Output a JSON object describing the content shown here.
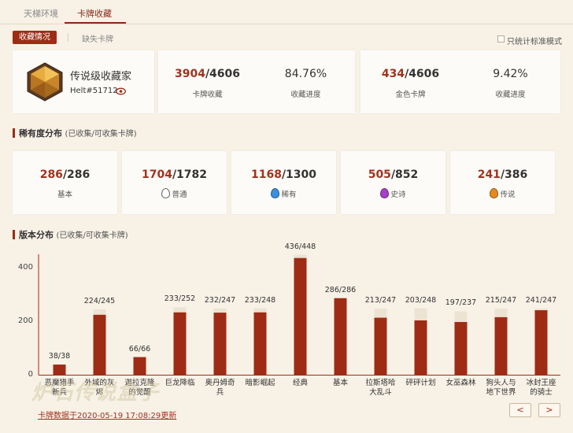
{
  "topnav": {
    "tab1": "天梯环境",
    "tab2": "卡牌收藏"
  },
  "subnav": {
    "active": "收藏情况",
    "other": "缺失卡牌",
    "checkbox_label": "只统计标准模式"
  },
  "profile": {
    "title": "传说级收藏家",
    "battletag": "Helt#51712"
  },
  "stats": [
    {
      "owned": "3904",
      "total": "/4606",
      "label": "卡牌收藏",
      "pct": "84.76%",
      "pct_label": "收藏进度"
    },
    {
      "owned": "434",
      "total": "/4606",
      "label": "金色卡牌",
      "pct": "9.42%",
      "pct_label": "收藏进度"
    }
  ],
  "rarity": {
    "title": "稀有度分布",
    "subtitle": "(已收集/可收集卡牌)",
    "items": [
      {
        "owned": "286",
        "total": "/286",
        "label": "基本",
        "gem": "",
        "color": ""
      },
      {
        "owned": "1704",
        "total": "/1782",
        "label": "普通",
        "gem": "common",
        "color": "#ffffff"
      },
      {
        "owned": "1168",
        "total": "/1300",
        "label": "稀有",
        "gem": "rare",
        "color": "#3a8fe0"
      },
      {
        "owned": "505",
        "total": "/852",
        "label": "史诗",
        "gem": "epic",
        "color": "#a640c9"
      },
      {
        "owned": "241",
        "total": "/386",
        "label": "传说",
        "gem": "legendary",
        "color": "#e78a1e"
      }
    ]
  },
  "expansion": {
    "title": "版本分布",
    "subtitle": "(已收集/可收集卡牌)"
  },
  "chart_data": {
    "type": "bar",
    "ylim": [
      0,
      480
    ],
    "yticks": [
      "0",
      "200",
      "400"
    ],
    "categories": [
      "恶魔猎手\n新兵",
      "外域的灰\n烬",
      "迦拉克隆\n的觉醒",
      "巨龙降临",
      "奥丹姆奇\n兵",
      "暗影崛起",
      "经典",
      "基本",
      "拉斯塔哈\n大乱斗",
      "砰砰计划",
      "女巫森林",
      "狗头人与\n地下世界",
      "冰封王座\n的骑士"
    ],
    "value_labels": [
      "38/38",
      "224/245",
      "66/66",
      "233/252",
      "232/247",
      "233/248",
      "436/448",
      "286/286",
      "213/247",
      "203/248",
      "197/237",
      "215/247",
      "241/247"
    ],
    "series": [
      {
        "name": "已收集",
        "values": [
          38,
          224,
          66,
          233,
          232,
          233,
          436,
          286,
          213,
          203,
          197,
          215,
          241
        ]
      },
      {
        "name": "可收集",
        "values": [
          38,
          245,
          66,
          252,
          247,
          248,
          448,
          286,
          247,
          248,
          237,
          247,
          247
        ]
      }
    ],
    "colors": {
      "owned": "#9e2c15",
      "total": "#ece3d2"
    }
  },
  "nav": {
    "prev": "<",
    "next": ">"
  },
  "footer": {
    "updated": "卡牌数据于2020-05-19 17:08:29更新"
  },
  "watermark": "炉石传说盒子"
}
